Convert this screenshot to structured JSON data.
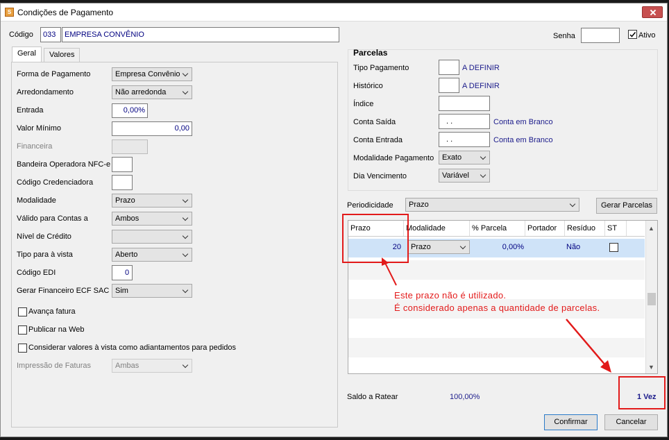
{
  "window": {
    "title": "Condições de Pagamento"
  },
  "header": {
    "codigo_label": "Código",
    "codigo_value": "033",
    "descricao_value": "EMPRESA CONVÊNIO",
    "senha_label": "Senha",
    "ativo_label": "Ativo",
    "ativo_checked": true
  },
  "tabs": [
    {
      "label": "Geral"
    },
    {
      "label": "Valores"
    }
  ],
  "geral": {
    "forma_pagamento": {
      "label": "Forma de Pagamento",
      "value": "Empresa Convênio"
    },
    "arredondamento": {
      "label": "Arredondamento",
      "value": "Não arredonda"
    },
    "entrada": {
      "label": "Entrada",
      "value": "0,00%"
    },
    "valor_minimo": {
      "label": "Valor Mínimo",
      "value": "0,00"
    },
    "financeira": {
      "label": "Financeira",
      "value": ""
    },
    "bandeira": {
      "label": "Bandeira Operadora NFC-e",
      "value": ""
    },
    "credenciadora": {
      "label": "Código Credenciadora",
      "value": ""
    },
    "modalidade": {
      "label": "Modalidade",
      "value": "Prazo"
    },
    "valido_contas": {
      "label": "Válido para Contas a",
      "value": "Ambos"
    },
    "nivel_credito": {
      "label": "Nível de Crédito",
      "value": ""
    },
    "tipo_vista": {
      "label": "Tipo para à vista",
      "value": "Aberto"
    },
    "codigo_edi": {
      "label": "Código EDI",
      "value": "0"
    },
    "gerar_financeiro": {
      "label": "Gerar Financeiro ECF SAC",
      "value": "Sim"
    },
    "avanca_fatura": {
      "label": "Avança fatura"
    },
    "publicar_web": {
      "label": "Publicar na Web"
    },
    "considerar_vista": {
      "label": "Considerar valores à vista como adiantamentos para pedidos"
    },
    "impressao_faturas": {
      "label": "Impressão de Faturas",
      "value": "Ambas"
    }
  },
  "parcelas": {
    "title": "Parcelas",
    "tipo_pagamento": {
      "label": "Tipo Pagamento",
      "link": "A DEFINIR"
    },
    "historico": {
      "label": "Histórico",
      "link": "A DEFINIR"
    },
    "indice": {
      "label": "Índice"
    },
    "conta_saida": {
      "label": "Conta Saída",
      "value": " .  .",
      "link": "Conta em Branco"
    },
    "conta_entrada": {
      "label": "Conta Entrada",
      "value": " .  .",
      "link": "Conta em Branco"
    },
    "modalidade_pagamento": {
      "label": "Modalidade Pagamento",
      "value": "Exato"
    },
    "dia_vencimento": {
      "label": "Dia Vencimento",
      "value": "Variável"
    }
  },
  "periodicidade": {
    "label": "Periodicidade",
    "value": "Prazo",
    "gerar_button": "Gerar Parcelas"
  },
  "grid": {
    "columns": [
      "Prazo",
      "Modalidade",
      "% Parcela",
      "Portador",
      "Resíduo",
      "ST"
    ],
    "rows": [
      {
        "prazo": "20",
        "modalidade": "Prazo",
        "parcela": "0,00%",
        "portador": "",
        "residuo": "Não",
        "st": false
      }
    ]
  },
  "annotation": {
    "line1": "Este prazo não é utilizado.",
    "line2": "É considerado apenas a quantidade de parcelas."
  },
  "footer": {
    "saldo_label": "Saldo a Ratear",
    "saldo_value": "100,00%",
    "vezes": "1 Vez",
    "confirmar": "Confirmar",
    "cancelar": "Cancelar"
  },
  "colors": {
    "annotation": "#e21a1a",
    "selected_row": "#cfe3f8",
    "link": "#1a1a8a"
  }
}
